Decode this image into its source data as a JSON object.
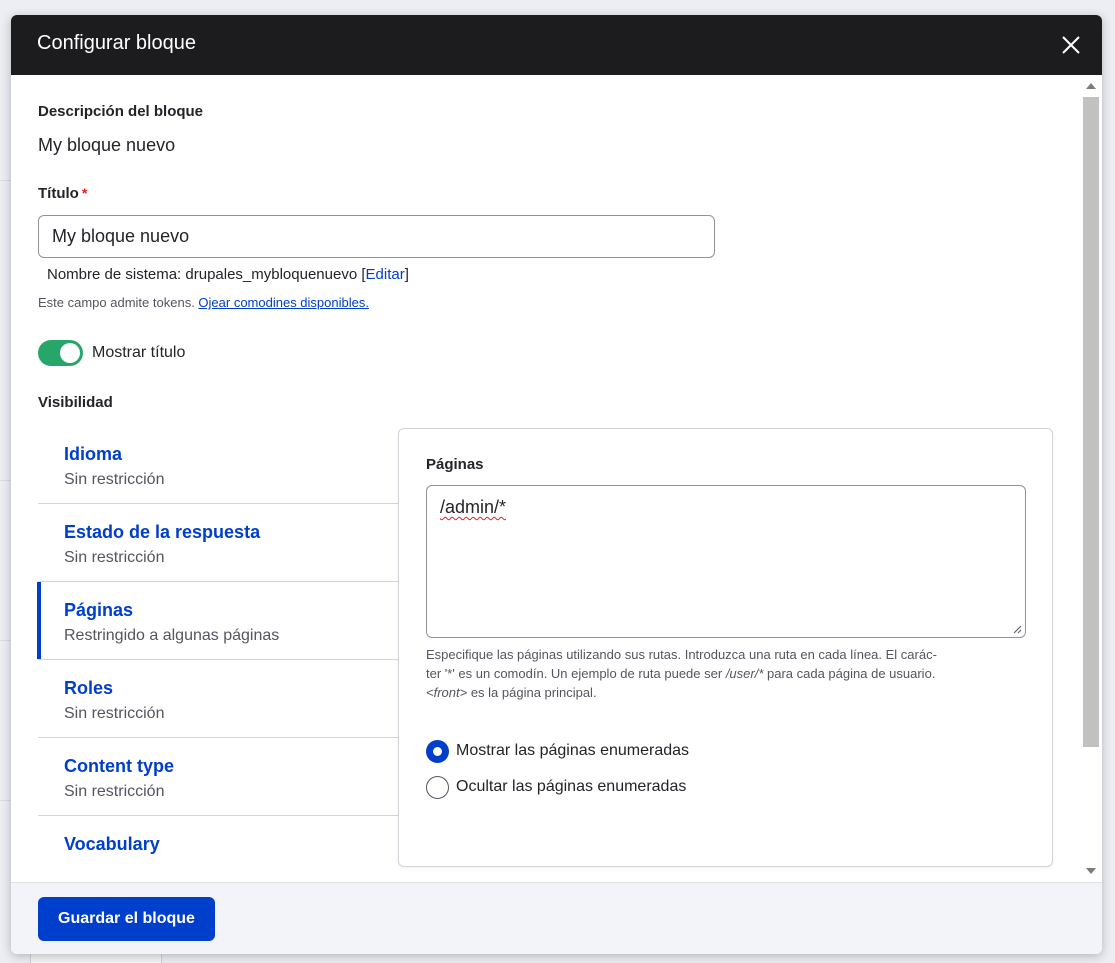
{
  "dialog": {
    "title": "Configurar bloque",
    "close_icon": "close-icon"
  },
  "form": {
    "description_label": "Descripción del bloque",
    "description_value": "My bloque nuevo",
    "title_label": "Título",
    "title_required_mark": "*",
    "title_value": "My bloque nuevo",
    "machine_name_text": "Nombre de sistema: drupales_mybloquenuevo [",
    "machine_name_edit": "Editar",
    "machine_name_close": "]",
    "tokens_help_text": "Este campo admite tokens. ",
    "tokens_help_link": "Ojear comodines disponibles.",
    "show_title_label": "Mostrar título",
    "show_title_on": true,
    "visibility_label": "Visibilidad"
  },
  "vertical_tabs": [
    {
      "title": "Idioma",
      "summary": "Sin restricción"
    },
    {
      "title": "Estado de la respuesta",
      "summary": "Sin restricción"
    },
    {
      "title": "Páginas",
      "summary": "Restringido a algunas páginas"
    },
    {
      "title": "Roles",
      "summary": "Sin restricción"
    },
    {
      "title": "Content type",
      "summary": "Sin restricción"
    },
    {
      "title": "Vocabulary",
      "summary": ""
    }
  ],
  "pages_pane": {
    "label": "Páginas",
    "textarea_value": "/admin/*",
    "help_line1": "Especifique las páginas utilizando sus rutas. Introduzca una ruta en cada línea. El carác-",
    "help_line2a": "ter '*' es un comodín. Un ejemplo de ruta puede ser ",
    "help_line2_em": "/user/*",
    "help_line2b": " para cada página de usuario.",
    "help_line3_em": "<front>",
    "help_line3b": " es la página principal.",
    "radio_show": "Mostrar las páginas enumeradas",
    "radio_hide": "Ocultar las páginas enumeradas",
    "selected": "show"
  },
  "footer": {
    "save_label": "Guardar el bloque"
  },
  "colors": {
    "accent": "#003ecc",
    "toggle_on": "#26a769",
    "titlebar": "#1c1c1f"
  }
}
